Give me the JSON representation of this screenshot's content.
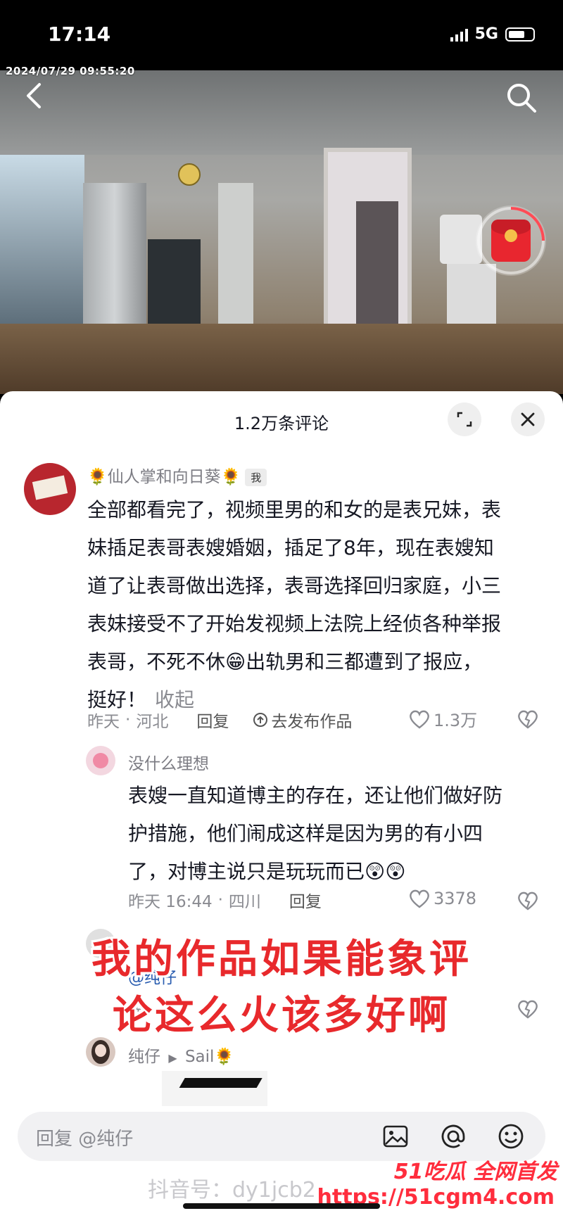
{
  "status_bar": {
    "time": "17:14",
    "network": "5G"
  },
  "video": {
    "timestamp": "2024/07/29 09:55:20",
    "calendar_char": "福"
  },
  "comments_panel": {
    "title": "1.2万条评论"
  },
  "comment1": {
    "author": "🌻仙人掌和向日葵🌻",
    "badge": "我",
    "lines": [
      "全部都看完了，视频里男的和女的是表兄妹，表",
      "妹插足表哥表嫂婚姻，插足了8年，现在表嫂知",
      "道了让表哥做出选择，表哥选择回归家庭，小三",
      "表妹接受不了开始发视频上法院上经侦各种举报",
      "表哥，不死不休😁出轨男和三都遭到了报应，",
      "挺好！"
    ],
    "collapse": "收起",
    "time": "昨天",
    "location": "河北",
    "reply": "回复",
    "publish": "去发布作品",
    "likes": "1.3万"
  },
  "comment2": {
    "author": "没什么理想",
    "lines": [
      "表嫂一直知道博主的存在，还让他们做好防",
      "护措施，他们闹成这样是因为男的有小四",
      "了，对博主说只是玩玩而已😲😲"
    ],
    "time": "昨天 16:44",
    "location": "四川",
    "reply": "回复",
    "likes": "3378"
  },
  "comment3": {
    "mention": "@纯仔",
    "partial_time": "昨"
  },
  "comment4": {
    "author": "纯仔",
    "reply_to": "Sail🌻"
  },
  "overlay": {
    "line1": "我的作品如果能象评",
    "line2": "论这么火该多好啊"
  },
  "reply_bar": {
    "placeholder": "回复 @纯仔"
  },
  "watermark": {
    "douyin_id": "抖音号：dy1jcb2wz"
  },
  "brand": {
    "line1": "51吃瓜 全网首发",
    "url": "https://51cgm4.com"
  },
  "colors": {
    "accent_red": "#e8292c",
    "text_gray": "#8a8b91"
  }
}
